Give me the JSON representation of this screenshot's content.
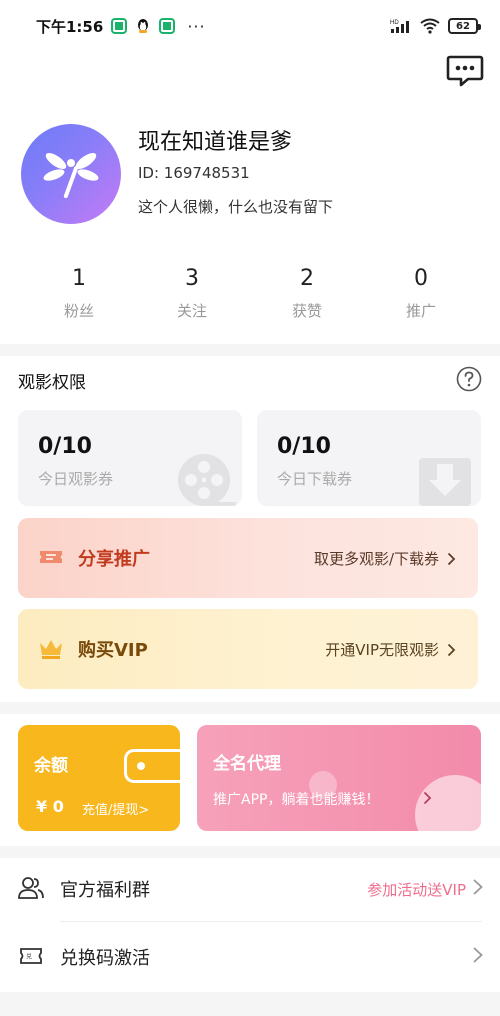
{
  "status_bar": {
    "time": "下午1:56",
    "dots": "···",
    "battery": "62"
  },
  "profile": {
    "name": "现在知道谁是爹",
    "id": "ID: 169748531",
    "bio": "这个人很懒，什么也没有留下"
  },
  "stats": [
    {
      "value": "1",
      "label": "粉丝"
    },
    {
      "value": "3",
      "label": "关注"
    },
    {
      "value": "2",
      "label": "获赞"
    },
    {
      "value": "0",
      "label": "推广"
    }
  ],
  "viewing": {
    "title": "观影权限",
    "cards": [
      {
        "count": "0/10",
        "label": "今日观影券",
        "icon": "film-reel-icon"
      },
      {
        "count": "0/10",
        "label": "今日下载券",
        "icon": "download-tray-icon"
      }
    ]
  },
  "promos": {
    "share": {
      "label": "分享推广",
      "right": "取更多观影/下载券"
    },
    "vip": {
      "label": "购买VIP",
      "right": "开通VIP无限观影"
    }
  },
  "balance": {
    "title": "余额",
    "amount": "¥ 0",
    "link": "充值/提现>"
  },
  "agent": {
    "title": "全名代理",
    "subtitle": "推广APP，躺着也能赚钱！"
  },
  "list": [
    {
      "label": "官方福利群",
      "right": "参加活动送VIP",
      "icon": "group-users-icon"
    },
    {
      "label": "兑换码激活",
      "right": "",
      "icon": "redeem-ticket-icon"
    }
  ],
  "colors": {
    "balance_bg": "#f7b71d",
    "agent_bg": "#f38bab",
    "share_accent": "#c23b1f",
    "vip_accent": "#7a4a0a",
    "list_accent": "#ef6d8c"
  }
}
